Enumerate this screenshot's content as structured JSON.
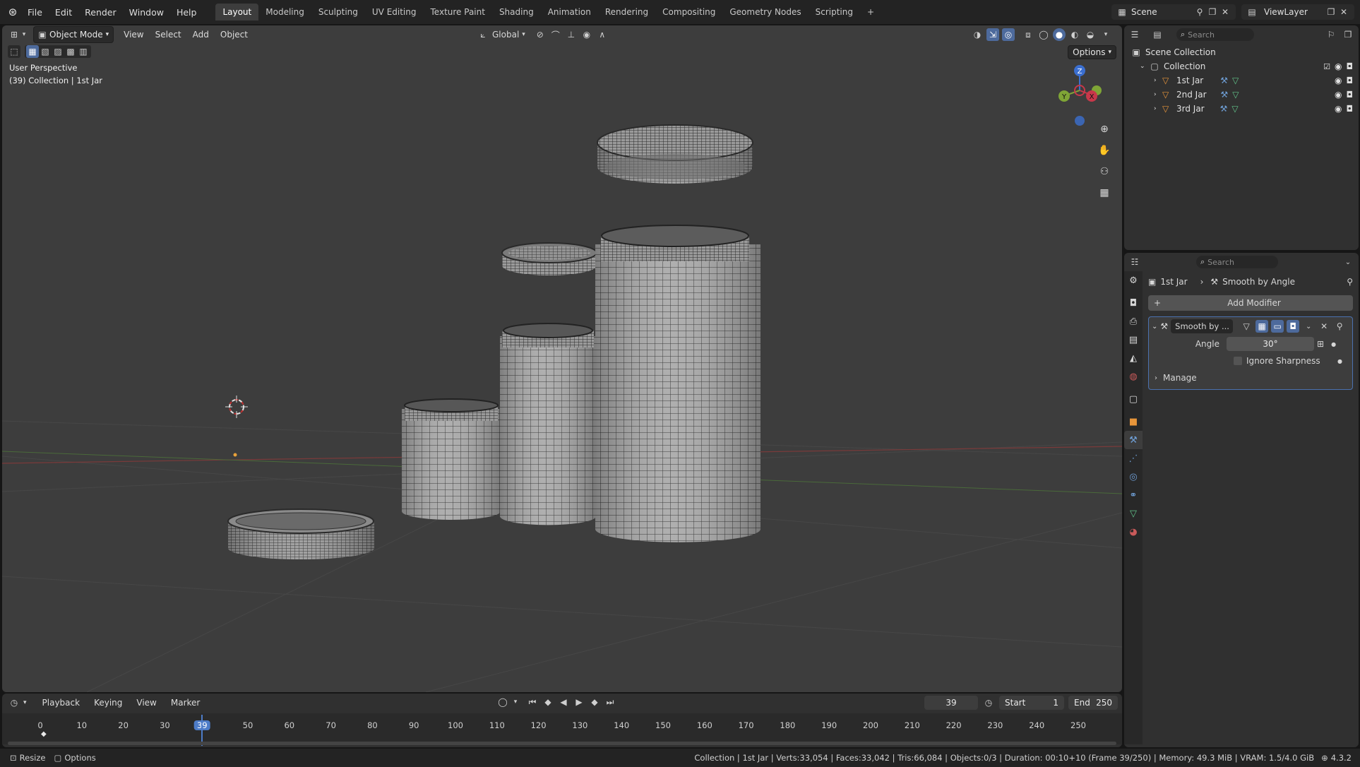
{
  "menu": [
    "File",
    "Edit",
    "Render",
    "Window",
    "Help"
  ],
  "workspaces": [
    "Layout",
    "Modeling",
    "Sculpting",
    "UV Editing",
    "Texture Paint",
    "Shading",
    "Animation",
    "Rendering",
    "Compositing",
    "Geometry Nodes",
    "Scripting"
  ],
  "active_workspace": "Layout",
  "add_workspace": "+",
  "scene": {
    "label": "Scene"
  },
  "view_layer": {
    "label": "ViewLayer"
  },
  "viewport": {
    "mode": "Object Mode",
    "menus": [
      "View",
      "Select",
      "Add",
      "Object"
    ],
    "orientation": "Global",
    "options": "Options",
    "overlay_line1": "User Perspective",
    "overlay_line2": "(39) Collection | 1st Jar",
    "gizmo": {
      "z": "Z",
      "y": "Y",
      "x": "X"
    }
  },
  "outliner": {
    "search_placeholder": "Search",
    "root": "Scene Collection",
    "collection": "Collection",
    "items": [
      "1st Jar",
      "2nd Jar",
      "3rd Jar"
    ]
  },
  "properties": {
    "search_placeholder": "Search",
    "breadcrumb_object": "1st Jar",
    "breadcrumb_modifier": "Smooth by Angle",
    "add_modifier": "Add Modifier",
    "modifier_name": "Smooth by ...",
    "angle_label": "Angle",
    "angle_value": "30°",
    "ignore_sharpness": "Ignore Sharpness",
    "manage": "Manage"
  },
  "timeline": {
    "menus": [
      "Playback",
      "Keying",
      "View",
      "Marker"
    ],
    "current_frame": "39",
    "start_label": "Start",
    "start_value": "1",
    "end_label": "End",
    "end_value": "250",
    "ticks": [
      "0",
      "10",
      "20",
      "30",
      "39",
      "50",
      "60",
      "70",
      "80",
      "90",
      "100",
      "110",
      "120",
      "130",
      "140",
      "150",
      "160",
      "170",
      "180",
      "190",
      "200",
      "210",
      "220",
      "230",
      "240",
      "250"
    ]
  },
  "status": {
    "left1": "Resize",
    "left2": "Options",
    "stats": "Collection | 1st Jar | Verts:33,054 | Faces:33,042 | Tris:66,084 | Objects:0/3 | Duration: 00:10+10 (Frame 39/250) | Memory: 49.3 MiB | VRAM: 1.5/4.0 GiB",
    "version": "4.3.2"
  }
}
